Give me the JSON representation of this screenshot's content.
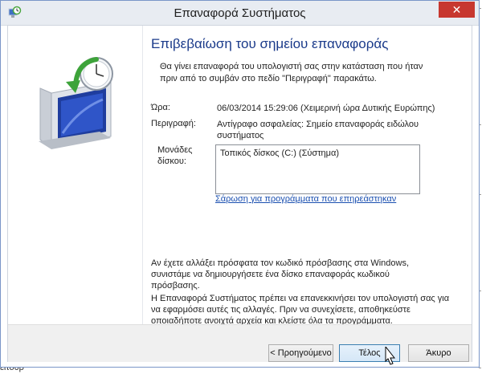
{
  "window": {
    "title": "Επαναφορά Συστήματος",
    "close_symbol": "✕"
  },
  "heading": "Επιβεβαίωση του σημείου επαναφοράς",
  "intro_line1": "Θα γίνει επαναφορά του υπολογιστή σας στην κατάσταση που ήταν",
  "intro_line2": "πριν από το συμβάν στο πεδίο \"Περιγραφή\" παρακάτω.",
  "fields": {
    "time_label": "Ώρα:",
    "time_value": "06/03/2014 15:29:06 (Χειμερινή ώρα Δυτικής Ευρώπης)",
    "desc_label": "Περιγραφή:",
    "desc_value_line1": "Αντίγραφο ασφαλείας: Σημείο επαναφοράς ειδώλου",
    "desc_value_line2": "συστήματος",
    "drives_label_line1": "Μονάδες",
    "drives_label_line2": "δίσκου:",
    "drives": [
      "Τοπικός δίσκος (C:) (Σύστημα)"
    ]
  },
  "scan_link": "Σάρωση για προγράμματα που επηρεάστηκαν",
  "password_note_line1": "Αν έχετε αλλάξει πρόσφατα τον κωδικό πρόσβασης στα Windows,",
  "password_note_line2": "συνιστάμε να δημιουργήσετε ένα δίσκο επαναφοράς κωδικού πρόσβασης.",
  "restart_note_line1": "Η Επαναφορά Συστήματος πρέπει να επανεκκινήσει τον υπολογιστή σας για",
  "restart_note_line2": "να εφαρμόσει αυτές τις αλλαγές. Πριν να συνεχίσετε, αποθηκεύστε",
  "restart_note_line3": "οποιαδήποτε ανοιχτά αρχεία και κλείστε όλα τα προγράμματα.",
  "buttons": {
    "back": "< Προηγούμενο",
    "finish": "Τέλος",
    "cancel": "Άκυρο"
  },
  "desktop_edge_text": "ειτουρ"
}
